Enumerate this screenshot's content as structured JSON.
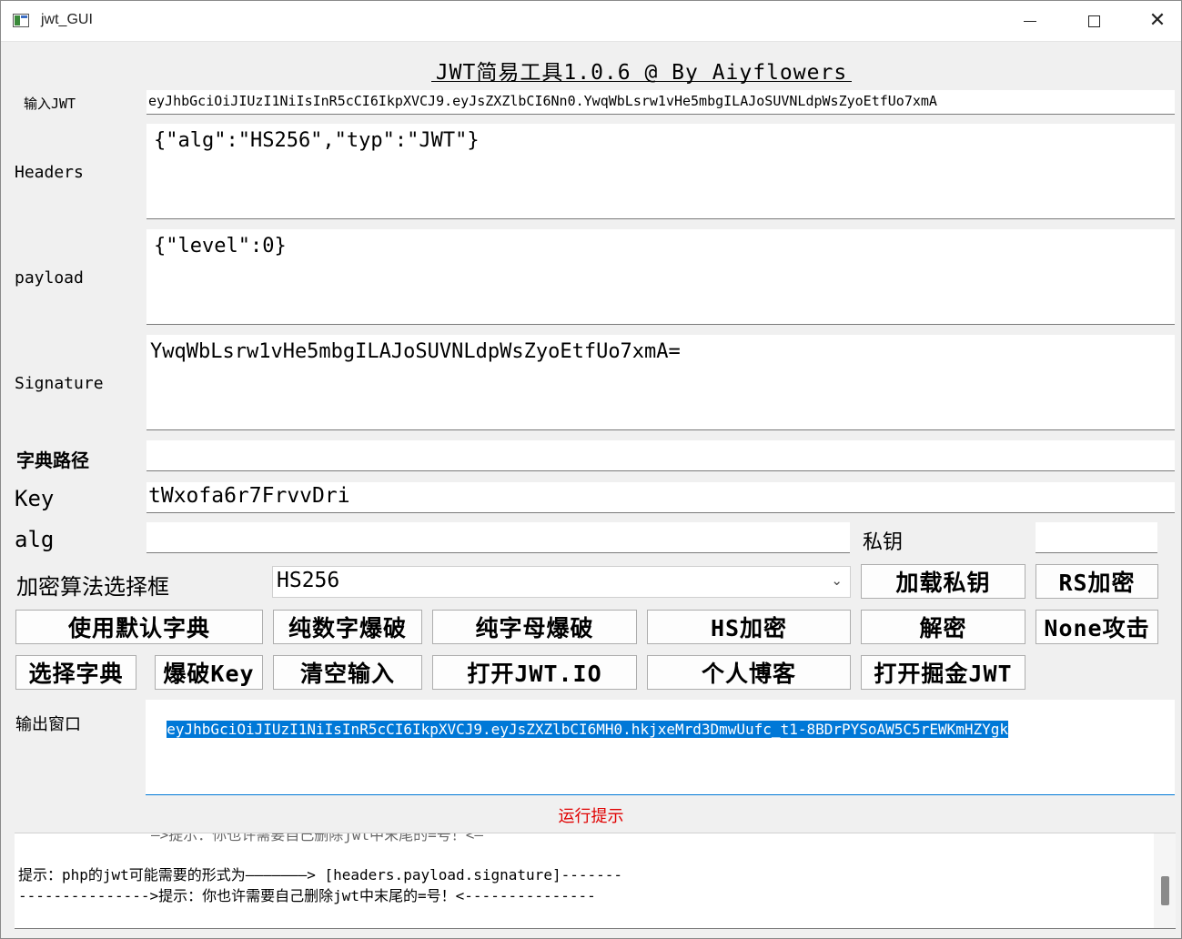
{
  "window": {
    "title": "jwt_GUI"
  },
  "header": "JWT简易工具1.0.6 @ By Aiyflowers",
  "labels": {
    "jwt_input": "输入JWT",
    "headers": "Headers",
    "payload": "payload",
    "signature": "Signature",
    "dict_path": "字典路径",
    "key": "Key",
    "alg": "alg",
    "private_key": "私钥",
    "algo_select": "加密算法选择框",
    "output": "输出窗口"
  },
  "fields": {
    "jwt_input": "eyJhbGciOiJIUzI1NiIsInR5cCI6IkpXVCJ9.eyJsZXZlbCI6Nn0.YwqWbLsrw1vHe5mbgILAJoSUVNLdpWsZyoEtfUo7xmA",
    "headers": "{\"alg\":\"HS256\",\"typ\":\"JWT\"}",
    "payload": "{\"level\":0}",
    "signature": "YwqWbLsrw1vHe5mbgILAJoSUVNLdpWsZyoEtfUo7xmA=",
    "dict_path": "",
    "key": "tWxofa6r7FrvvDri",
    "alg": "",
    "private_key": "",
    "algo_selected": "HS256",
    "output": "eyJhbGciOiJIUzI1NiIsInR5cCI6IkpXVCJ9.eyJsZXZlbCI6MH0.hkjxeMrd3DmwUufc_t1-8BDrPYSoAW5C5rEWKmHZYgk"
  },
  "buttons": {
    "load_private_key": "加载私钥",
    "rs_encrypt": "RS加密",
    "use_default_dict": "使用默认字典",
    "numeric_brute": "纯数字爆破",
    "alpha_brute": "纯字母爆破",
    "hs_encrypt": "HS加密",
    "decrypt": "解密",
    "none_attack": "None攻击",
    "choose_dict": "选择字典",
    "brute_key": "爆破Key",
    "clear_input": "清空输入",
    "open_jwt_io": "打开JWT.IO",
    "personal_blog": "个人博客",
    "open_juejin_jwt": "打开掘金JWT"
  },
  "status": "运行提示",
  "log": {
    "line0": "—>提示：你也许需要自己删除jwt中末尾的=号！<—",
    "line1": "提示：php的jwt可能需要的形式为———————> [headers.payload.signature]-------",
    "line2": "--------------->提示：你也许需要自己删除jwt中末尾的=号！<---------------"
  }
}
